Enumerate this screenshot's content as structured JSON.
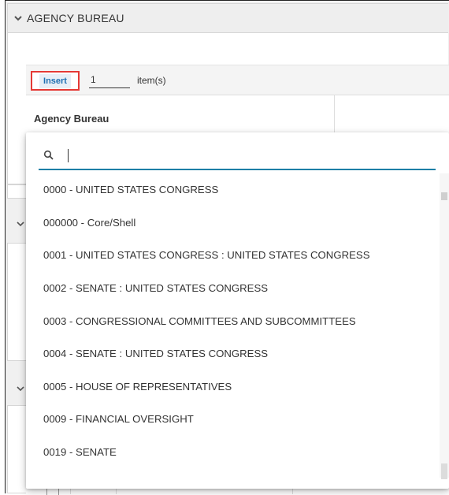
{
  "section": {
    "title": "AGENCY BUREAU"
  },
  "toolbar": {
    "insert_label": "Insert",
    "quantity_value": "1",
    "items_label": "item(s)"
  },
  "grid": {
    "column_header": "Agency Bureau"
  },
  "dropdown": {
    "search_value": "",
    "accent_color": "#1d7fa6",
    "options": [
      "0000 - UNITED STATES CONGRESS",
      "000000 - Core/Shell",
      "0001 - UNITED STATES CONGRESS : UNITED STATES CONGRESS",
      "0002 - SENATE : UNITED STATES CONGRESS",
      "0003 - CONGRESSIONAL COMMITTEES AND SUBCOMMITTEES",
      "0004 - SENATE : UNITED STATES CONGRESS",
      "0005 - HOUSE OF REPRESENTATIVES",
      "0009 - FINANCIAL OVERSIGHT",
      "0019 - SENATE"
    ]
  },
  "colors": {
    "highlight_border": "#e53935",
    "insert_text": "#1f6fb2"
  }
}
